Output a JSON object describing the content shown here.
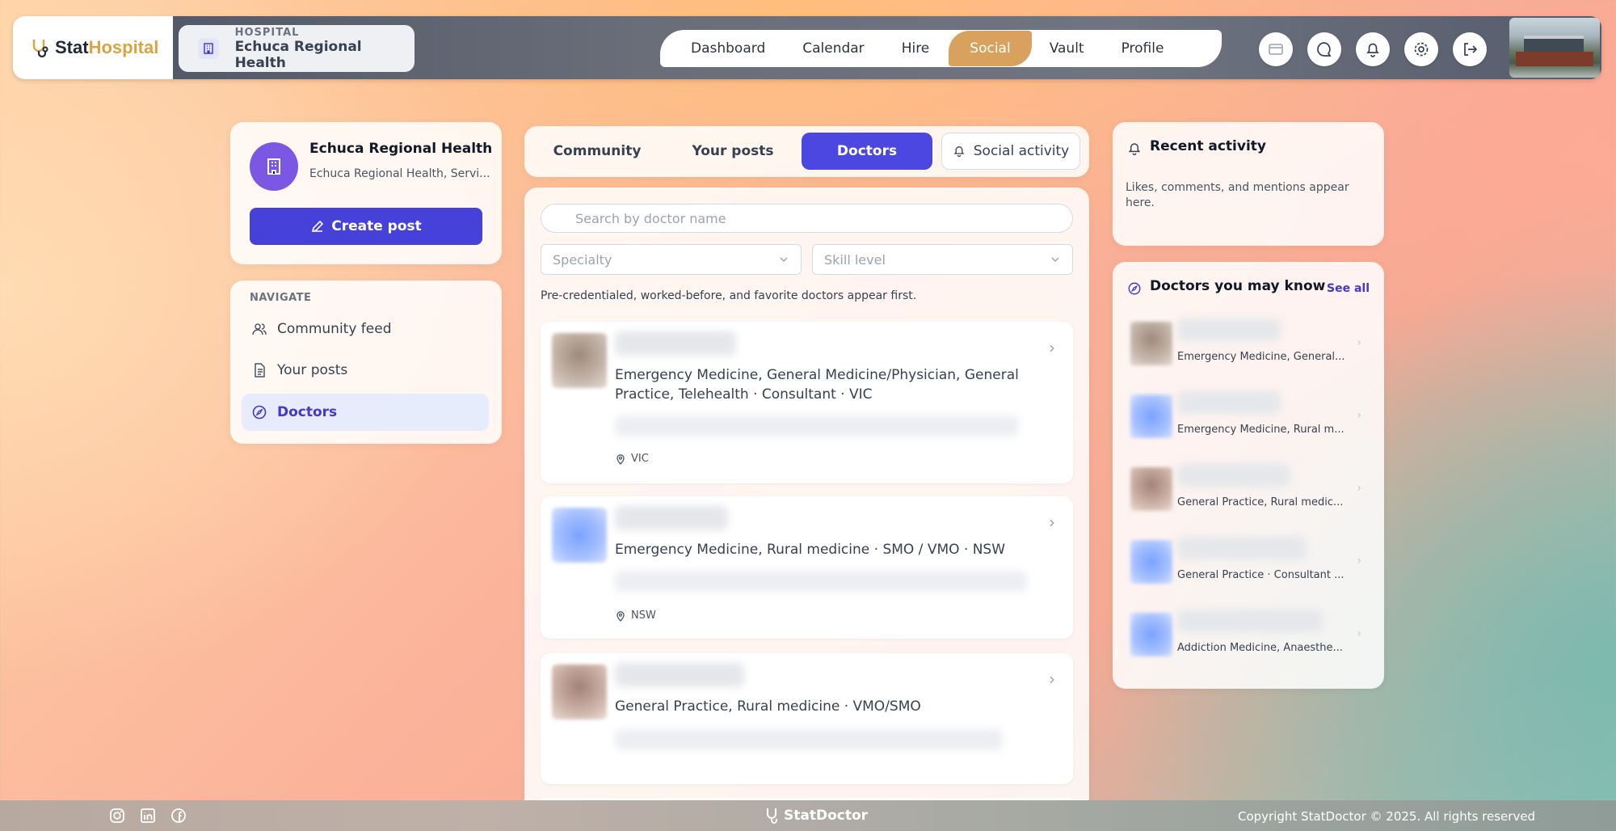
{
  "brand": {
    "stat": "Stat",
    "hospital": "Hospital"
  },
  "hospital_chip": {
    "kicker": "HOSPITAL",
    "name": "Echuca Regional Health"
  },
  "top_nav": [
    "Dashboard",
    "Calendar",
    "Hire",
    "Social",
    "Vault",
    "Profile"
  ],
  "top_nav_active": "Social",
  "header_icons": [
    "card-icon",
    "chat-icon",
    "bell-icon",
    "gear-icon",
    "logout-icon"
  ],
  "profile": {
    "org_name": "Echuca Regional Health",
    "org_sub": "Echuca Regional Health, Servi...",
    "create_post": "Create post"
  },
  "navigate": {
    "label": "NAVIGATE",
    "items": [
      "Community feed",
      "Your posts",
      "Doctors"
    ],
    "active": "Doctors"
  },
  "tabs": [
    "Community",
    "Your posts",
    "Doctors",
    "Social activity"
  ],
  "tabs_active": "Doctors",
  "search": {
    "placeholder": "Search by doctor name"
  },
  "filters": {
    "specialty": "Specialty",
    "skill": "Skill level"
  },
  "hint": "Pre-credentialed, worked-before, and favorite doctors appear first.",
  "doctors": [
    {
      "specialty": "Emergency Medicine, General Medicine/Physician, General Practice, Telehealth · Consultant · VIC",
      "location": "VIC"
    },
    {
      "specialty": "Emergency Medicine, Rural medicine · SMO / VMO · NSW",
      "location": "NSW"
    },
    {
      "specialty": "General Practice, Rural medicine · VMO/SMO",
      "location": ""
    }
  ],
  "recent": {
    "title": "Recent activity",
    "body": "Likes, comments, and mentions appear here."
  },
  "may_know": {
    "title": "Doctors you may know",
    "see_all": "See all",
    "items": [
      "Emergency Medicine, General...",
      "Emergency Medicine, Rural m...",
      "General Practice, Rural medic...",
      "General Practice · Consultant ...",
      "Addiction Medicine, Anaesthe..."
    ]
  },
  "footer": {
    "brand": "StatDoctor",
    "copyright": "Copyright StatDoctor © 2025. All rights reserved"
  },
  "colors": {
    "primary": "#4b47e0",
    "accent": "#d8a25e",
    "brand_gold": "#d9a441"
  }
}
